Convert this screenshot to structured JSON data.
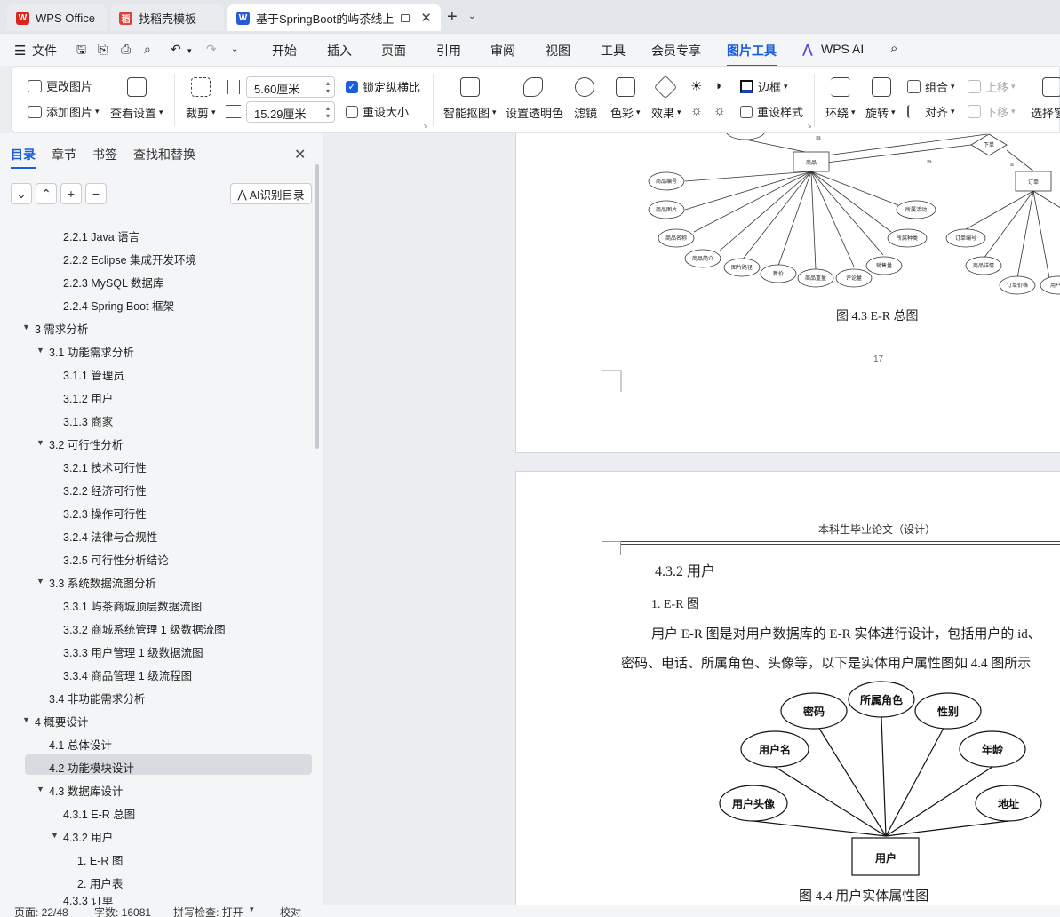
{
  "tabs": [
    {
      "label": "WPS Office",
      "color": "#d9261c",
      "glyph": "W"
    },
    {
      "label": "找稻壳模板",
      "color": "#e0403a",
      "glyph": "稻"
    },
    {
      "label": "基于SpringBoot的屿茶线上商",
      "color": "#2a5bd7",
      "glyph": "W"
    }
  ],
  "menu": {
    "file": "文件",
    "items": [
      "开始",
      "插入",
      "页面",
      "引用",
      "审阅",
      "视图",
      "工具",
      "会员专享",
      "图片工具",
      "WPS AI"
    ]
  },
  "ribbon": {
    "change_image": "更改图片",
    "add_image": "添加图片",
    "view_settings": "查看设置",
    "crop": "裁剪",
    "width": "5.60厘米",
    "height": "15.29厘米",
    "lock_ratio": "锁定纵横比",
    "reset_size": "重设大小",
    "smart_cutout": "智能抠图",
    "set_transparent": "设置透明色",
    "filter": "滤镜",
    "color": "色彩",
    "effects": "效果",
    "border": "边框",
    "reset_style": "重设样式",
    "wrap": "环绕",
    "rotate": "旋转",
    "group": "组合",
    "align": "对齐",
    "move_up": "上移",
    "move_down": "下移",
    "select_pane": "选择窗"
  },
  "sidebar": {
    "tabs": [
      "目录",
      "章节",
      "书签",
      "查找和替换"
    ],
    "ai_toc": "AI识别目录",
    "toc": [
      "2.2.1 Java 语言",
      "2.2.2 Eclipse 集成开发环境",
      "2.2.3 MySQL 数据库",
      "2.2.4 Spring Boot 框架",
      "3  需求分析",
      "3.1  功能需求分析",
      "3.1.1  管理员",
      "3.1.2  用户",
      "3.1.3  商家",
      "3.2 可行性分析",
      "3.2.1  技术可行性",
      "3.2.2  经济可行性",
      "3.2.3  操作可行性",
      "3.2.4  法律与合规性",
      "3.2.5  可行性分析结论",
      "3.3  系统数据流图分析",
      "3.3.1 屿茶商城顶层数据流图",
      "3.3.2  商城系统管理 1 级数据流图",
      "3.3.3  用户管理 1 级数据流图",
      "3.3.4  商品管理 1 级流程图",
      "3.4  非功能需求分析",
      "4  概要设计",
      "4.1  总体设计",
      "4.2  功能模块设计",
      "4.3  数据库设计",
      "4.3.1 E-R 总图",
      "4.3.2  用户",
      "1. E-R 图",
      "2.  用户表",
      "4.3.3  订单"
    ]
  },
  "doc": {
    "page1": {
      "er_labels": {
        "center": "商品",
        "order": "订单",
        "relation": "下单",
        "m1": "m",
        "m2": "m",
        "n": "n",
        "attrs": [
          "商品编号",
          "商品图片",
          "商品名称",
          "商品简介",
          "图片路径",
          "新价",
          "商品重量",
          "评论量",
          "销售量",
          "所属种类",
          "所属活动"
        ],
        "order_attrs": [
          "订单编号",
          "商品详情",
          "订单价格",
          "用户姓"
        ]
      },
      "caption": "图 4.3 E-R 总图",
      "page_number": "17"
    },
    "page2": {
      "header": "本科生毕业论文（设计）",
      "section": "4.3.2  用户",
      "sub": "1. E-R 图",
      "para1": "用户 E-R 图是对用户数据库的 E-R 实体进行设计，包括用户的 id、",
      "para2": "密码、电话、所属角色、头像等，以下是实体用户属性图如 4.4 图所示",
      "er": {
        "entity": "用户",
        "attrs": [
          "密码",
          "所属角色",
          "性别",
          "用户名",
          "年龄",
          "用户头像",
          "地址"
        ]
      },
      "caption": "图 4.4  用户实体属性图"
    }
  },
  "status": {
    "page": "页面: 22/48",
    "words": "字数: 16081",
    "spell": "拼写检查: 打开",
    "proof": "校对"
  }
}
